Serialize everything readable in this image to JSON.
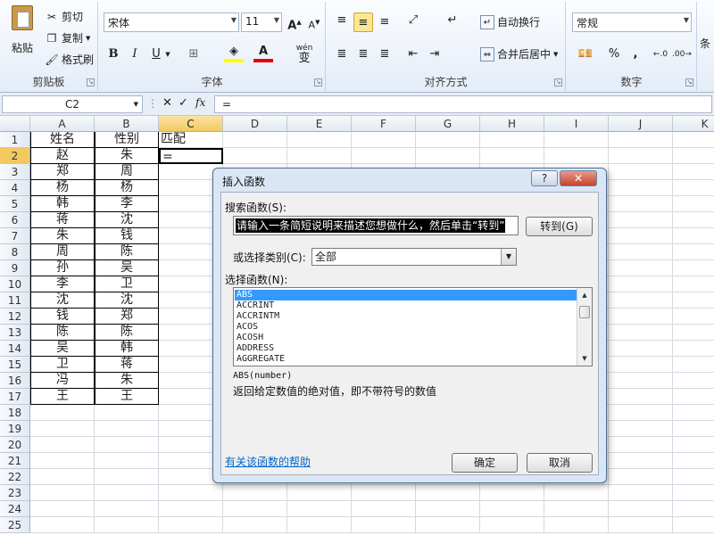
{
  "ribbon": {
    "clipboard": {
      "paste": "粘贴",
      "cut": "剪切",
      "copy": "复制",
      "format_painter": "格式刷",
      "group": "剪贴板"
    },
    "font": {
      "name": "宋体",
      "size": "11",
      "bold": "B",
      "italic": "I",
      "underline": "U",
      "group": "字体",
      "grow": "A",
      "shrink": "A",
      "wen": "wén",
      "wen_char": "变"
    },
    "alignment": {
      "wrap_text": "自动换行",
      "merge_center": "合并后居中",
      "group": "对齐方式"
    },
    "number": {
      "format": "常规",
      "percent": "%",
      "comma": ",",
      "group": "数字"
    },
    "cut_off": "条"
  },
  "formula_bar": {
    "name_box": "C2",
    "fx": "fx",
    "cancel": "✕",
    "enter": "✓",
    "value": "="
  },
  "columns": [
    "A",
    "B",
    "C",
    "D",
    "E",
    "F",
    "G",
    "H",
    "I",
    "J",
    "K"
  ],
  "rows": [
    "1",
    "2",
    "3",
    "4",
    "5",
    "6",
    "7",
    "8",
    "9",
    "10",
    "11",
    "12",
    "13",
    "14",
    "15",
    "16",
    "17",
    "18",
    "19",
    "20",
    "21",
    "22",
    "23",
    "24",
    "25"
  ],
  "data": {
    "header": [
      "姓名",
      "性别",
      "匹配"
    ],
    "colA": [
      "赵",
      "郑",
      "杨",
      "韩",
      "蒋",
      "朱",
      "周",
      "孙",
      "李",
      "沈",
      "钱",
      "陈",
      "吴",
      "卫",
      "冯",
      "王"
    ],
    "colB": [
      "朱",
      "周",
      "杨",
      "李",
      "沈",
      "钱",
      "陈",
      "吴",
      "卫",
      "沈",
      "郑",
      "陈",
      "韩",
      "蒋",
      "朱",
      "王"
    ],
    "c2": "="
  },
  "dialog": {
    "title": "插入函数",
    "help_btn": "?",
    "close_btn": "✕",
    "search_label": "搜索函数(S):",
    "search_text": "请输入一条简短说明来描述您想做什么，然后单击“转到”",
    "go_button": "转到(G)",
    "category_label": "或选择类别(C):",
    "category_value": "全部",
    "select_label": "选择函数(N):",
    "functions": [
      "ABS",
      "ACCRINT",
      "ACCRINTM",
      "ACOS",
      "ACOSH",
      "ADDRESS",
      "AGGREGATE"
    ],
    "signature": "ABS(number)",
    "description": "返回给定数值的绝对值，即不带符号的数值",
    "help_link": "有关该函数的帮助",
    "ok": "确定",
    "cancel": "取消"
  }
}
